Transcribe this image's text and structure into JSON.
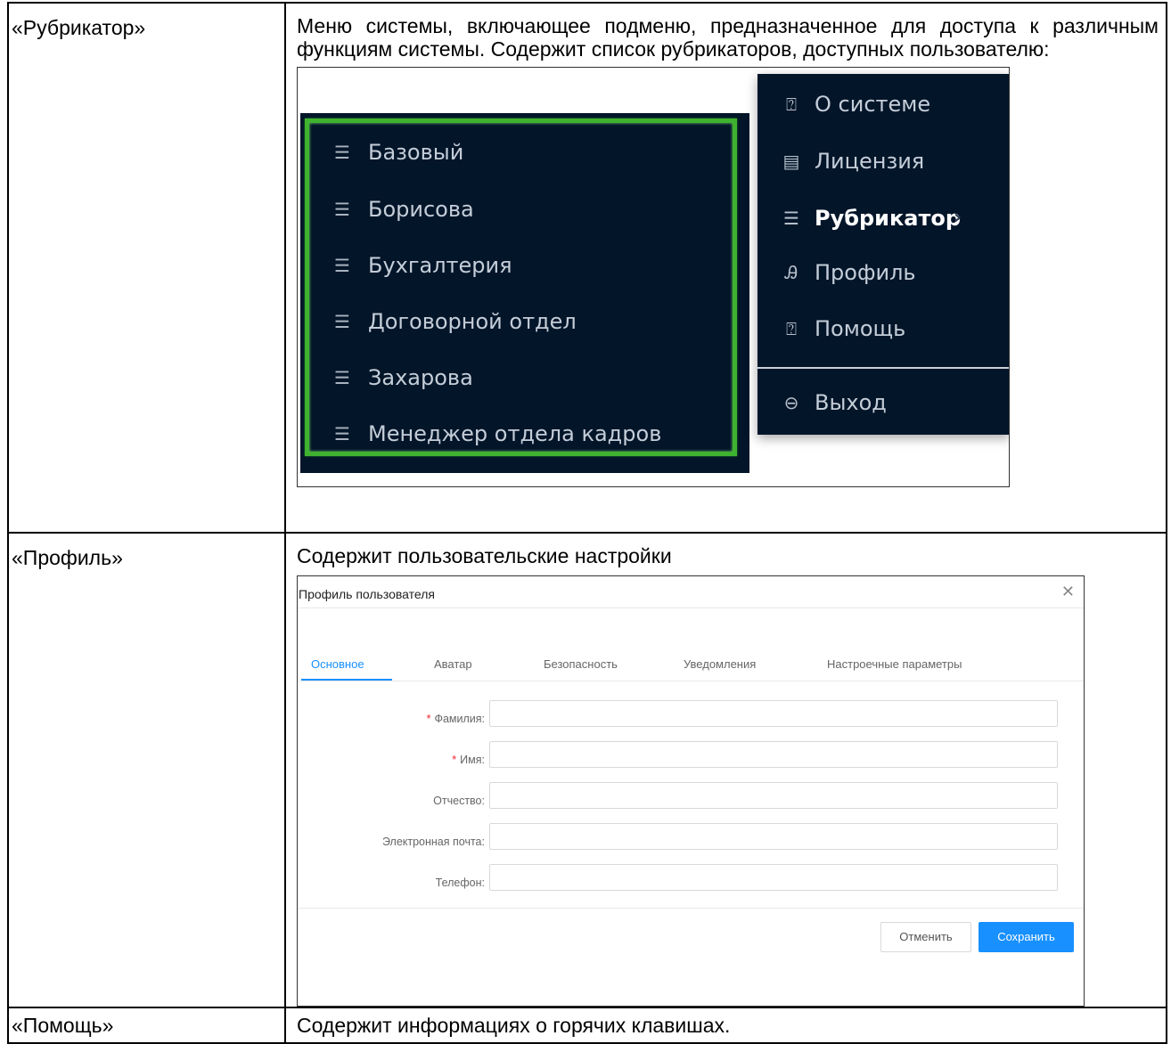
{
  "rows": [
    {
      "name": "«Рубрикатор»",
      "description": "Меню системы, включающее подменю, предназначенное для доступа к различным функциям системы. Содержит список рубрикаторов, доступных пользователю:"
    },
    {
      "name": "«Профиль»",
      "description": "Содержит пользовательские настройки"
    },
    {
      "name": "«Помощь»",
      "description": "Содержит информациях о горячих клавишах."
    }
  ],
  "menu": {
    "submenu_items": [
      "Базовый",
      "Борисова",
      "Бухгалтерия",
      "Договорной отдел",
      "Захарова",
      "Менеджер отдела кадров"
    ],
    "main_items": [
      {
        "icon": "question-circle-icon",
        "label": "О системе"
      },
      {
        "icon": "license-icon",
        "label": "Лицензия"
      },
      {
        "icon": "list-icon",
        "label": "Рубрикатор",
        "active": true
      },
      {
        "icon": "user-icon",
        "label": "Профиль"
      },
      {
        "icon": "question-circle-icon",
        "label": "Помощь"
      },
      {
        "icon": "logout-icon",
        "label": "Выход"
      }
    ],
    "colors": {
      "menu_bg": "#031529",
      "highlight": "#3fb32f"
    }
  },
  "profile_dialog": {
    "title": "Профиль пользователя",
    "tabs": [
      "Основное",
      "Аватар",
      "Безопасность",
      "Уведомления",
      "Настроечные параметры"
    ],
    "active_tab": "Основное",
    "fields": [
      {
        "label": "Фамилия",
        "required": true,
        "value": ""
      },
      {
        "label": "Имя",
        "required": true,
        "value": ""
      },
      {
        "label": "Отчество",
        "required": false,
        "value": ""
      },
      {
        "label": "Электронная почта",
        "required": false,
        "value": ""
      },
      {
        "label": "Телефон",
        "required": false,
        "value": ""
      }
    ],
    "cancel_label": "Отменить",
    "save_label": "Сохранить",
    "colors": {
      "accent": "#1890ff",
      "required": "#f5222d"
    }
  }
}
